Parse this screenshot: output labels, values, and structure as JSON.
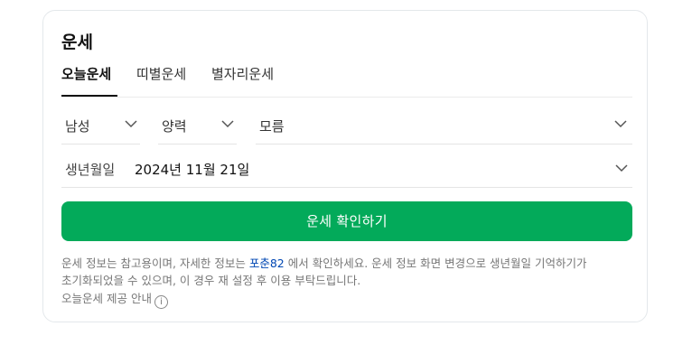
{
  "widget": {
    "title": "운세"
  },
  "tabs": [
    {
      "label": "오늘운세",
      "active": true
    },
    {
      "label": "띠별운세",
      "active": false
    },
    {
      "label": "별자리운세",
      "active": false
    }
  ],
  "selects": {
    "gender": "남성",
    "calendar": "양력",
    "time": "모름"
  },
  "birth": {
    "label": "생년월일",
    "value": "2024년 11월 21일"
  },
  "button": {
    "label": "운세 확인하기"
  },
  "notice": {
    "before_link": "운세 정보는 참고용이며, 자세한 정보는 ",
    "link": "포춘82",
    "after_link": " 에서 확인하세요. 운세 정보 화면 변경으로 생년월일 기억하기가 초기화되었을 수 있으며, 이 경우 재 설정 후 이용 부탁드립니다."
  },
  "guide": {
    "label": "오늘운세 제공 안내",
    "icon": "ⓘ"
  },
  "colors": {
    "accent": "#03aa5a",
    "link": "#0047b3"
  }
}
